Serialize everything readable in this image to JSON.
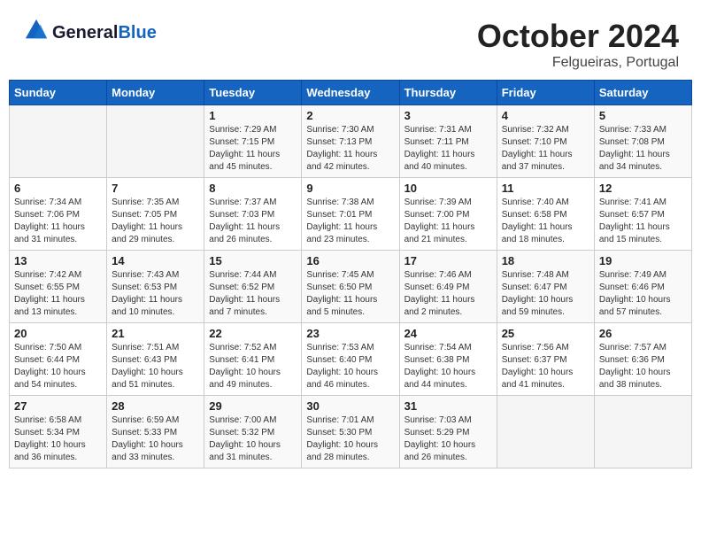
{
  "header": {
    "logo_line1": "General",
    "logo_line2": "Blue",
    "month": "October 2024",
    "location": "Felgueiras, Portugal"
  },
  "weekdays": [
    "Sunday",
    "Monday",
    "Tuesday",
    "Wednesday",
    "Thursday",
    "Friday",
    "Saturday"
  ],
  "weeks": [
    [
      {
        "day": "",
        "info": ""
      },
      {
        "day": "",
        "info": ""
      },
      {
        "day": "1",
        "info": "Sunrise: 7:29 AM\nSunset: 7:15 PM\nDaylight: 11 hours and 45 minutes."
      },
      {
        "day": "2",
        "info": "Sunrise: 7:30 AM\nSunset: 7:13 PM\nDaylight: 11 hours and 42 minutes."
      },
      {
        "day": "3",
        "info": "Sunrise: 7:31 AM\nSunset: 7:11 PM\nDaylight: 11 hours and 40 minutes."
      },
      {
        "day": "4",
        "info": "Sunrise: 7:32 AM\nSunset: 7:10 PM\nDaylight: 11 hours and 37 minutes."
      },
      {
        "day": "5",
        "info": "Sunrise: 7:33 AM\nSunset: 7:08 PM\nDaylight: 11 hours and 34 minutes."
      }
    ],
    [
      {
        "day": "6",
        "info": "Sunrise: 7:34 AM\nSunset: 7:06 PM\nDaylight: 11 hours and 31 minutes."
      },
      {
        "day": "7",
        "info": "Sunrise: 7:35 AM\nSunset: 7:05 PM\nDaylight: 11 hours and 29 minutes."
      },
      {
        "day": "8",
        "info": "Sunrise: 7:37 AM\nSunset: 7:03 PM\nDaylight: 11 hours and 26 minutes."
      },
      {
        "day": "9",
        "info": "Sunrise: 7:38 AM\nSunset: 7:01 PM\nDaylight: 11 hours and 23 minutes."
      },
      {
        "day": "10",
        "info": "Sunrise: 7:39 AM\nSunset: 7:00 PM\nDaylight: 11 hours and 21 minutes."
      },
      {
        "day": "11",
        "info": "Sunrise: 7:40 AM\nSunset: 6:58 PM\nDaylight: 11 hours and 18 minutes."
      },
      {
        "day": "12",
        "info": "Sunrise: 7:41 AM\nSunset: 6:57 PM\nDaylight: 11 hours and 15 minutes."
      }
    ],
    [
      {
        "day": "13",
        "info": "Sunrise: 7:42 AM\nSunset: 6:55 PM\nDaylight: 11 hours and 13 minutes."
      },
      {
        "day": "14",
        "info": "Sunrise: 7:43 AM\nSunset: 6:53 PM\nDaylight: 11 hours and 10 minutes."
      },
      {
        "day": "15",
        "info": "Sunrise: 7:44 AM\nSunset: 6:52 PM\nDaylight: 11 hours and 7 minutes."
      },
      {
        "day": "16",
        "info": "Sunrise: 7:45 AM\nSunset: 6:50 PM\nDaylight: 11 hours and 5 minutes."
      },
      {
        "day": "17",
        "info": "Sunrise: 7:46 AM\nSunset: 6:49 PM\nDaylight: 11 hours and 2 minutes."
      },
      {
        "day": "18",
        "info": "Sunrise: 7:48 AM\nSunset: 6:47 PM\nDaylight: 10 hours and 59 minutes."
      },
      {
        "day": "19",
        "info": "Sunrise: 7:49 AM\nSunset: 6:46 PM\nDaylight: 10 hours and 57 minutes."
      }
    ],
    [
      {
        "day": "20",
        "info": "Sunrise: 7:50 AM\nSunset: 6:44 PM\nDaylight: 10 hours and 54 minutes."
      },
      {
        "day": "21",
        "info": "Sunrise: 7:51 AM\nSunset: 6:43 PM\nDaylight: 10 hours and 51 minutes."
      },
      {
        "day": "22",
        "info": "Sunrise: 7:52 AM\nSunset: 6:41 PM\nDaylight: 10 hours and 49 minutes."
      },
      {
        "day": "23",
        "info": "Sunrise: 7:53 AM\nSunset: 6:40 PM\nDaylight: 10 hours and 46 minutes."
      },
      {
        "day": "24",
        "info": "Sunrise: 7:54 AM\nSunset: 6:38 PM\nDaylight: 10 hours and 44 minutes."
      },
      {
        "day": "25",
        "info": "Sunrise: 7:56 AM\nSunset: 6:37 PM\nDaylight: 10 hours and 41 minutes."
      },
      {
        "day": "26",
        "info": "Sunrise: 7:57 AM\nSunset: 6:36 PM\nDaylight: 10 hours and 38 minutes."
      }
    ],
    [
      {
        "day": "27",
        "info": "Sunrise: 6:58 AM\nSunset: 5:34 PM\nDaylight: 10 hours and 36 minutes."
      },
      {
        "day": "28",
        "info": "Sunrise: 6:59 AM\nSunset: 5:33 PM\nDaylight: 10 hours and 33 minutes."
      },
      {
        "day": "29",
        "info": "Sunrise: 7:00 AM\nSunset: 5:32 PM\nDaylight: 10 hours and 31 minutes."
      },
      {
        "day": "30",
        "info": "Sunrise: 7:01 AM\nSunset: 5:30 PM\nDaylight: 10 hours and 28 minutes."
      },
      {
        "day": "31",
        "info": "Sunrise: 7:03 AM\nSunset: 5:29 PM\nDaylight: 10 hours and 26 minutes."
      },
      {
        "day": "",
        "info": ""
      },
      {
        "day": "",
        "info": ""
      }
    ]
  ]
}
